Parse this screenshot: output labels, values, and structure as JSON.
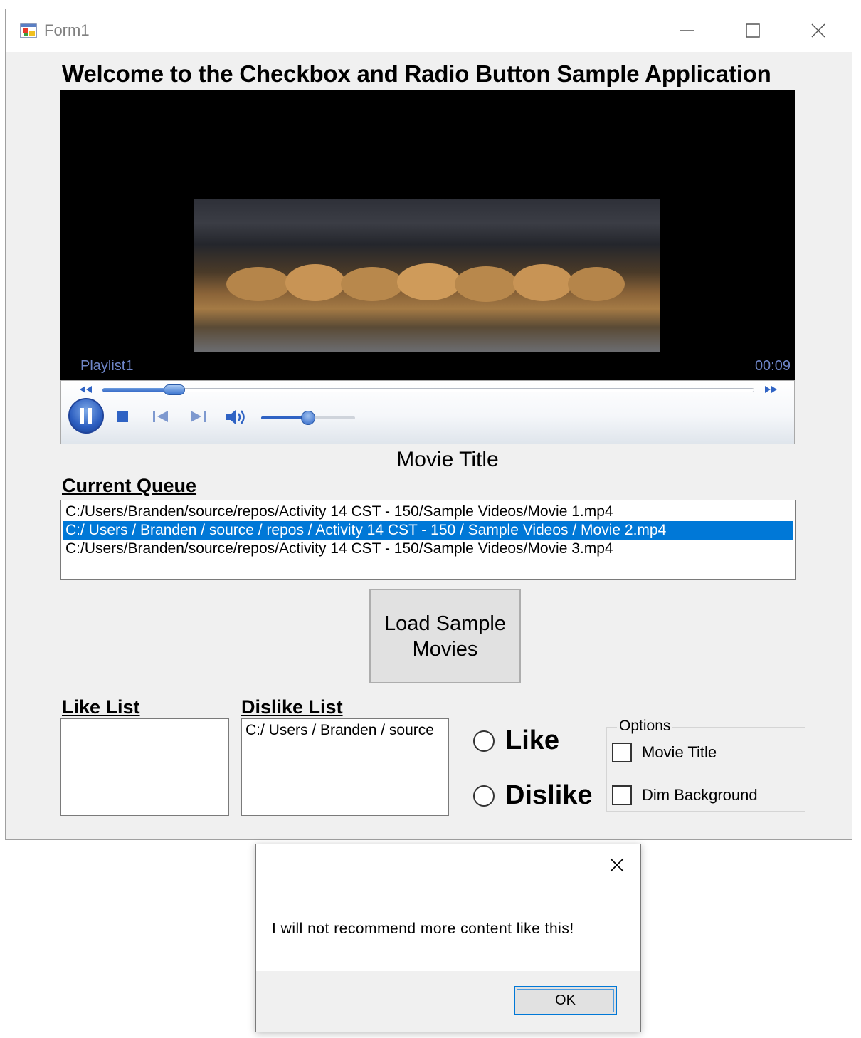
{
  "window": {
    "title": "Form1"
  },
  "heading": "Welcome to the Checkbox and Radio Button Sample Application",
  "player": {
    "playlist": "Playlist1",
    "time": "00:09",
    "seek_progress": 0.11,
    "volume": 0.5
  },
  "movie_title": "Movie Title",
  "queue": {
    "label": "Current Queue",
    "items": [
      "C:/Users/Branden/source/repos/Activity 14 CST - 150/Sample Videos/Movie 1.mp4",
      "C:/ Users / Branden / source / repos / Activity 14 CST - 150 / Sample Videos / Movie 2.mp4",
      "C:/Users/Branden/source/repos/Activity 14 CST - 150/Sample Videos/Movie 3.mp4"
    ],
    "selected_index": 1
  },
  "load_button": {
    "line1": "Load Sample",
    "line2": "Movies"
  },
  "like_list": {
    "label": "Like List",
    "items": []
  },
  "dislike_list": {
    "label": "Dislike List",
    "items": [
      "C:/ Users / Branden / source"
    ]
  },
  "radios": {
    "like": "Like",
    "dislike": "Dislike"
  },
  "options": {
    "legend": "Options",
    "movie_title": "Movie Title",
    "dim_background": "Dim Background"
  },
  "message_box": {
    "text": "I will not recommend more content like this!",
    "ok": "OK"
  }
}
